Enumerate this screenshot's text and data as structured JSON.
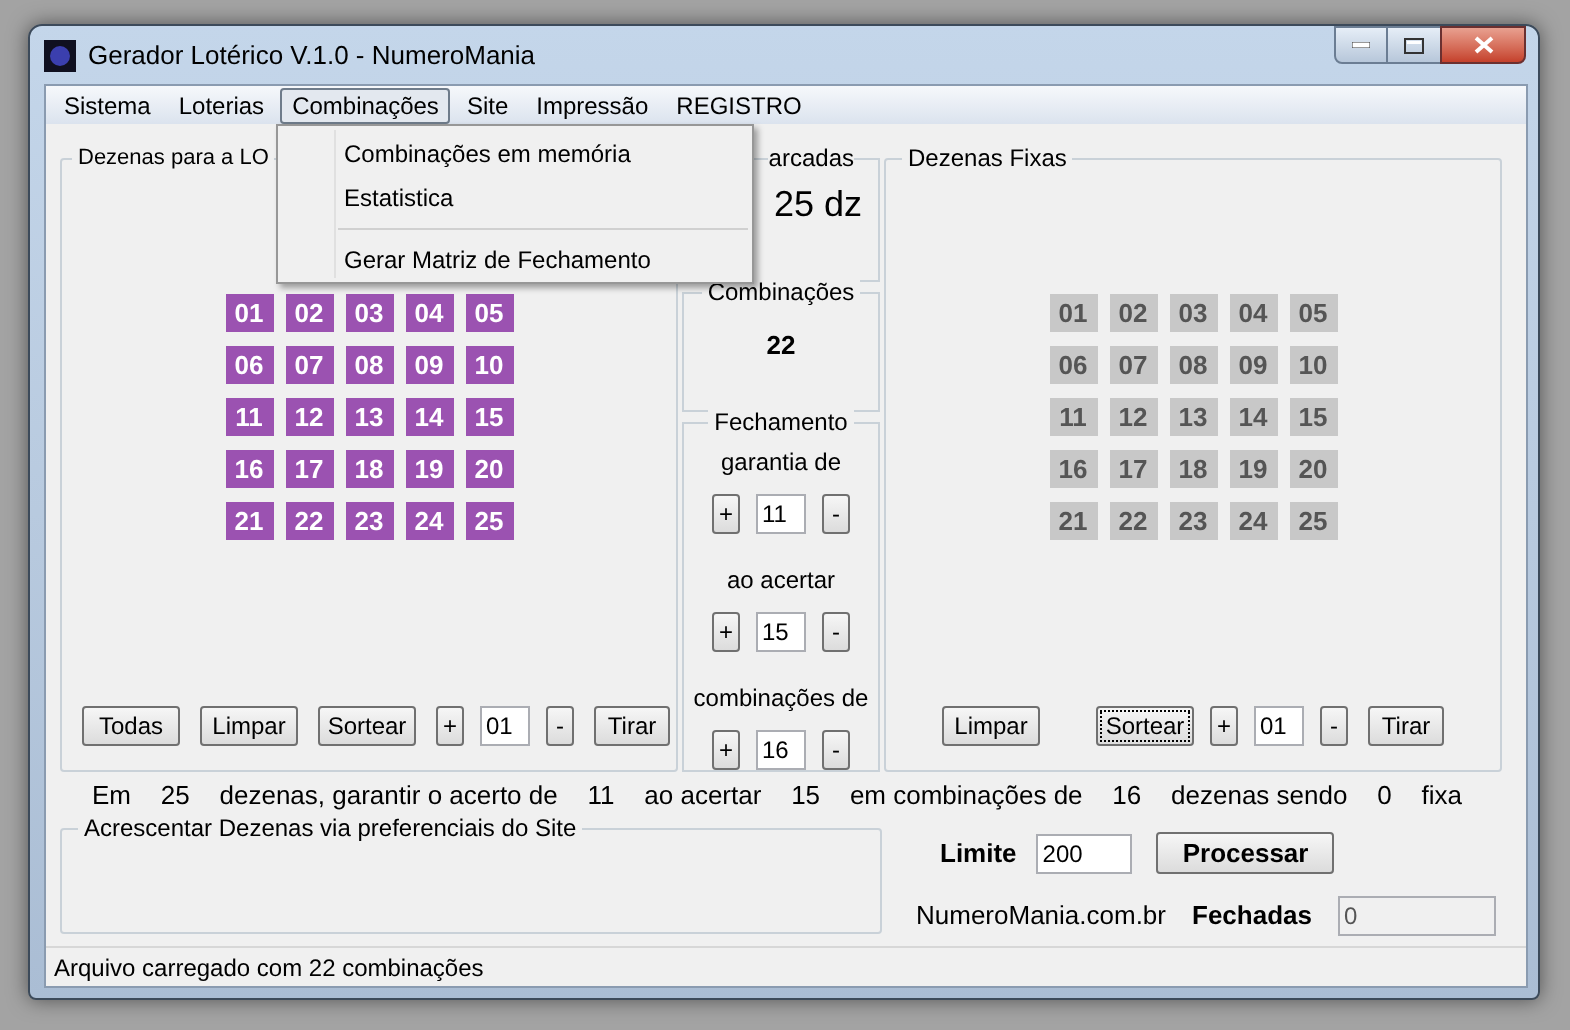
{
  "window": {
    "title": "Gerador Lotérico V.1.0 - NumeroMania"
  },
  "menu": [
    {
      "label": "Sistema",
      "selected": false
    },
    {
      "label": "Loterias",
      "selected": false
    },
    {
      "label": "Combinações",
      "selected": true
    },
    {
      "label": "Site",
      "selected": false
    },
    {
      "label": "Impressão",
      "selected": false
    },
    {
      "label": "REGISTRO",
      "selected": false
    }
  ],
  "open_menu": [
    {
      "kind": "item",
      "label": "Combinações em memória"
    },
    {
      "kind": "item",
      "label": "Estatistica"
    },
    {
      "kind": "separator"
    },
    {
      "kind": "item",
      "label": "Gerar Matriz de Fechamento"
    }
  ],
  "left_group": {
    "title": "Dezenas para a LO",
    "numbers": [
      {
        "label": "01",
        "selected": true
      },
      {
        "label": "02",
        "selected": true
      },
      {
        "label": "03",
        "selected": true
      },
      {
        "label": "04",
        "selected": true
      },
      {
        "label": "05",
        "selected": true
      },
      {
        "label": "06",
        "selected": true
      },
      {
        "label": "07",
        "selected": true
      },
      {
        "label": "08",
        "selected": true
      },
      {
        "label": "09",
        "selected": true
      },
      {
        "label": "10",
        "selected": true
      },
      {
        "label": "11",
        "selected": true
      },
      {
        "label": "12",
        "selected": true
      },
      {
        "label": "13",
        "selected": true
      },
      {
        "label": "14",
        "selected": true
      },
      {
        "label": "15",
        "selected": true
      },
      {
        "label": "16",
        "selected": true
      },
      {
        "label": "17",
        "selected": true
      },
      {
        "label": "18",
        "selected": true
      },
      {
        "label": "19",
        "selected": true
      },
      {
        "label": "20",
        "selected": true
      },
      {
        "label": "21",
        "selected": true
      },
      {
        "label": "22",
        "selected": true
      },
      {
        "label": "23",
        "selected": true
      },
      {
        "label": "24",
        "selected": true
      },
      {
        "label": "25",
        "selected": true
      }
    ],
    "buttons": [
      {
        "label": "Todas",
        "focused": false
      },
      {
        "label": "Limpar",
        "focused": false
      },
      {
        "label": "Sortear",
        "focused": false
      }
    ],
    "plus": "+",
    "count": "01",
    "minus": "-",
    "remove": "Tirar"
  },
  "marked": {
    "title": "arcadas",
    "value": "25 dz"
  },
  "combinations": {
    "title": "Combinações",
    "value": "22"
  },
  "closing": {
    "title": "Fechamento",
    "plus": "+",
    "minus": "-",
    "rows": [
      {
        "label": "garantia de",
        "value": "11"
      },
      {
        "label": "ao acertar",
        "value": "15"
      },
      {
        "label": "combinações de",
        "value": "16"
      }
    ]
  },
  "right_group": {
    "title": "Dezenas Fixas",
    "numbers": [
      {
        "label": "01",
        "selected": false
      },
      {
        "label": "02",
        "selected": false
      },
      {
        "label": "03",
        "selected": false
      },
      {
        "label": "04",
        "selected": false
      },
      {
        "label": "05",
        "selected": false
      },
      {
        "label": "06",
        "selected": false
      },
      {
        "label": "07",
        "selected": false
      },
      {
        "label": "08",
        "selected": false
      },
      {
        "label": "09",
        "selected": false
      },
      {
        "label": "10",
        "selected": false
      },
      {
        "label": "11",
        "selected": false
      },
      {
        "label": "12",
        "selected": false
      },
      {
        "label": "13",
        "selected": false
      },
      {
        "label": "14",
        "selected": false
      },
      {
        "label": "15",
        "selected": false
      },
      {
        "label": "16",
        "selected": false
      },
      {
        "label": "17",
        "selected": false
      },
      {
        "label": "18",
        "selected": false
      },
      {
        "label": "19",
        "selected": false
      },
      {
        "label": "20",
        "selected": false
      },
      {
        "label": "21",
        "selected": false
      },
      {
        "label": "22",
        "selected": false
      },
      {
        "label": "23",
        "selected": false
      },
      {
        "label": "24",
        "selected": false
      },
      {
        "label": "25",
        "selected": false
      }
    ],
    "buttons": [
      {
        "label": "Limpar",
        "focused": false
      },
      {
        "label": "Sortear",
        "focused": true
      }
    ],
    "plus": "+",
    "count": "01",
    "minus": "-",
    "remove": "Tirar"
  },
  "summary": [
    "Em",
    "25",
    "dezenas, garantir o acerto de",
    "11",
    "ao acertar",
    "15",
    "em combinações de",
    "16",
    "dezenas sendo",
    "0",
    "fixa"
  ],
  "preferences_group": {
    "title": "Acrescentar Dezenas via preferenciais do Site"
  },
  "limit": {
    "label": "Limite",
    "value": "200"
  },
  "process_button": "Processar",
  "site_label": "NumeroMania.com.br",
  "closed": {
    "label": "Fechadas",
    "value": "0"
  },
  "status_bar": "Arquivo carregado com 22 combinações"
}
